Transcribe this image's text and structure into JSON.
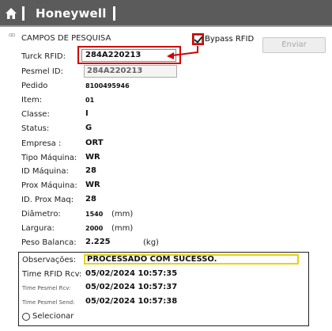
{
  "header": {
    "brand": "Honeywell",
    "home_icon": "home-icon"
  },
  "form": {
    "section_title": "CAMPOS DE PESQUISA",
    "bypass_rfid_label": "Bypass RFID",
    "bypass_rfid_checked": true,
    "enviar_label": "Enviar",
    "turck_label": "Turck RFID:",
    "turck_value": "284A220213",
    "pesmel_label": "Pesmel ID:",
    "pesmel_value": "284A220213"
  },
  "fields": {
    "pedido": {
      "label": "Pedido",
      "value": "8100495946"
    },
    "item": {
      "label": "Item:",
      "value": "01"
    },
    "classe": {
      "label": "Classe:",
      "value": "I"
    },
    "status": {
      "label": "Status:",
      "value": "G"
    },
    "empresa": {
      "label": "Empresa :",
      "value": "ORT"
    },
    "tipo_maquina": {
      "label": "Tipo Máquina:",
      "value": "WR"
    },
    "id_maquina": {
      "label": "ID Máquina:",
      "value": "28"
    },
    "prox_maquina": {
      "label": "Prox Máquina:",
      "value": "WR"
    },
    "id_prox_maq": {
      "label": "ID. Prox Maq:",
      "value": "28"
    },
    "diametro": {
      "label": "Diâmetro:",
      "value": "1540",
      "unit": "(mm)"
    },
    "largura": {
      "label": "Largura:",
      "value": "2000",
      "unit": "(mm)"
    },
    "peso_balanca": {
      "label": "Peso Balanca:",
      "value": "2.225",
      "unit": "(kg)"
    }
  },
  "observacoes": {
    "label": "Observações:",
    "message": "PROCESSADO COM SUCESSO.",
    "time_rfid_rcv_label": "Time RFID Rcv:",
    "time_rfid_rcv_value": "05/02/2024 10:57:35",
    "time_pesmel_rcv_label": "Time Pesmel Rcv:",
    "time_pesmel_rcv_value": "05/02/2024 10:57:37",
    "time_pesmel_send_label": "Time Pesmel Send:",
    "time_pesmel_send_value": "05/02/2024 10:57:38",
    "selecionar_label": "Selecionar"
  },
  "colors": {
    "header_bg": "#5b5b5b",
    "highlight_red": "#d10000",
    "success_box_yellow": "#e6d400"
  }
}
